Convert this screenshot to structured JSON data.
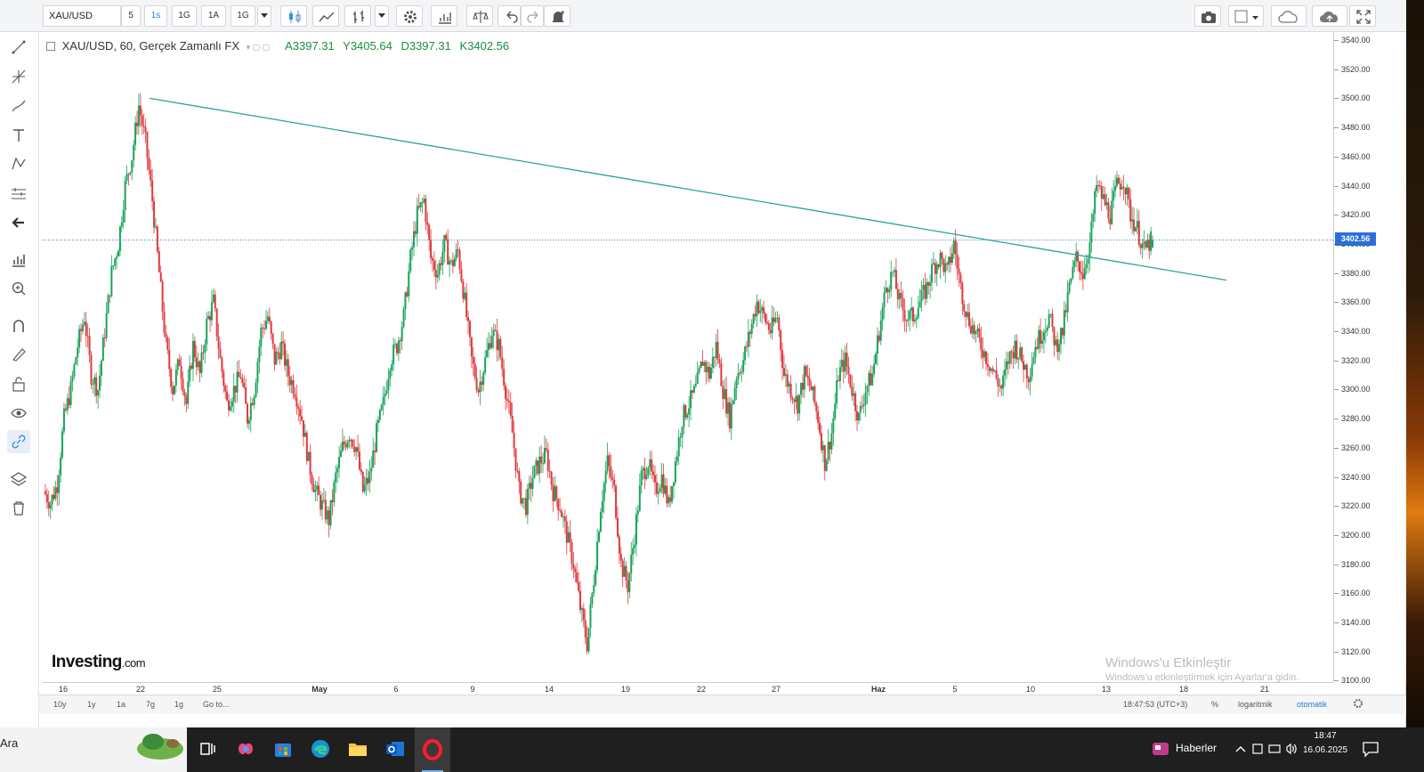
{
  "toolbar": {
    "symbol": "XAU/USD",
    "intervals": [
      "5",
      "1s",
      "1G",
      "1A",
      "1G"
    ],
    "active_interval": "1s"
  },
  "legend": {
    "title": "XAU/USD, 60, Gerçek Zamanlı FX",
    "open": "A3397.31",
    "high": "Y3405.64",
    "low": "D3397.31",
    "close": "K3402.56"
  },
  "price_axis": {
    "ticks": [
      "3540.00",
      "3520.00",
      "3500.00",
      "3480.00",
      "3460.00",
      "3440.00",
      "3420.00",
      "3400.00",
      "3380.00",
      "3360.00",
      "3340.00",
      "3320.00",
      "3300.00",
      "3280.00",
      "3260.00",
      "3240.00",
      "3220.00",
      "3200.00",
      "3180.00",
      "3160.00",
      "3140.00",
      "3120.00",
      "3100.00"
    ],
    "current_price": "3402.56"
  },
  "time_axis": {
    "ticks": [
      "16",
      "22",
      "25",
      "May",
      "6",
      "9",
      "14",
      "19",
      "22",
      "27",
      "Haz",
      "5",
      "10",
      "13",
      "18",
      "21"
    ]
  },
  "bottom_bar": {
    "ranges": [
      "10y",
      "1y",
      "1a",
      "7g",
      "1g"
    ],
    "goto": "Go to...",
    "time": "18:47:53 (UTC+3)",
    "percent": "%",
    "log": "logaritmik",
    "auto": "otomatik"
  },
  "watermark": {
    "line1": "Windows'u Etkinleştir",
    "line2": "Windows'u etkinleştirmek için Ayarlar'a gidin."
  },
  "logo": {
    "brand": "Investing",
    "suffix": ".com"
  },
  "taskbar": {
    "search": "Ara",
    "news": "Haberler",
    "time": "18:47",
    "date": "16.06.2025"
  },
  "colors": {
    "up": "#1aa35a",
    "down": "#e0393e",
    "trendline": "#2aa39b",
    "price_line": "#2b6fd6"
  },
  "chart_data": {
    "type": "line",
    "series": [
      {
        "values": [
          3230,
          3222,
          3235,
          3280,
          3300,
          3330,
          3350,
          3310,
          3300,
          3340,
          3380,
          3400,
          3440,
          3460,
          3495,
          3470,
          3430,
          3380,
          3330,
          3300,
          3320,
          3290,
          3330,
          3310,
          3345,
          3360,
          3320,
          3290,
          3300,
          3310,
          3280,
          3300,
          3340,
          3350,
          3320,
          3330,
          3310,
          3300,
          3280,
          3250,
          3230,
          3220,
          3210,
          3240,
          3260,
          3270,
          3260,
          3230,
          3240,
          3270,
          3290,
          3320,
          3330,
          3350,
          3390,
          3420,
          3430,
          3390,
          3380,
          3400,
          3385,
          3395,
          3360,
          3320,
          3300,
          3320,
          3340,
          3330,
          3300,
          3270,
          3230,
          3220,
          3240,
          3250,
          3255,
          3230,
          3220,
          3200,
          3180,
          3150,
          3125,
          3170,
          3220,
          3250,
          3230,
          3180,
          3165,
          3200,
          3240,
          3250,
          3230,
          3240,
          3220,
          3250,
          3280,
          3290,
          3300,
          3320,
          3310,
          3330,
          3300,
          3280,
          3310,
          3320,
          3340,
          3360,
          3350,
          3340,
          3350,
          3310,
          3300,
          3290,
          3310,
          3300,
          3280,
          3250,
          3270,
          3310,
          3320,
          3300,
          3280,
          3300,
          3310,
          3340,
          3370,
          3380,
          3360,
          3350,
          3350,
          3360,
          3370,
          3385,
          3390,
          3380,
          3400,
          3370,
          3350,
          3340,
          3330,
          3320,
          3310,
          3300,
          3320,
          3330,
          3320,
          3310,
          3330,
          3340,
          3350,
          3330,
          3340,
          3370,
          3390,
          3380,
          3400,
          3440,
          3430,
          3420,
          3440,
          3445,
          3420,
          3410,
          3395,
          3402
        ]
      }
    ],
    "trendline": {
      "from": [
        "Apr 22",
        3500
      ],
      "to": [
        "Jun 19",
        3375
      ]
    },
    "ylim": [
      3100,
      3545
    ],
    "current_price": 3402.56
  }
}
